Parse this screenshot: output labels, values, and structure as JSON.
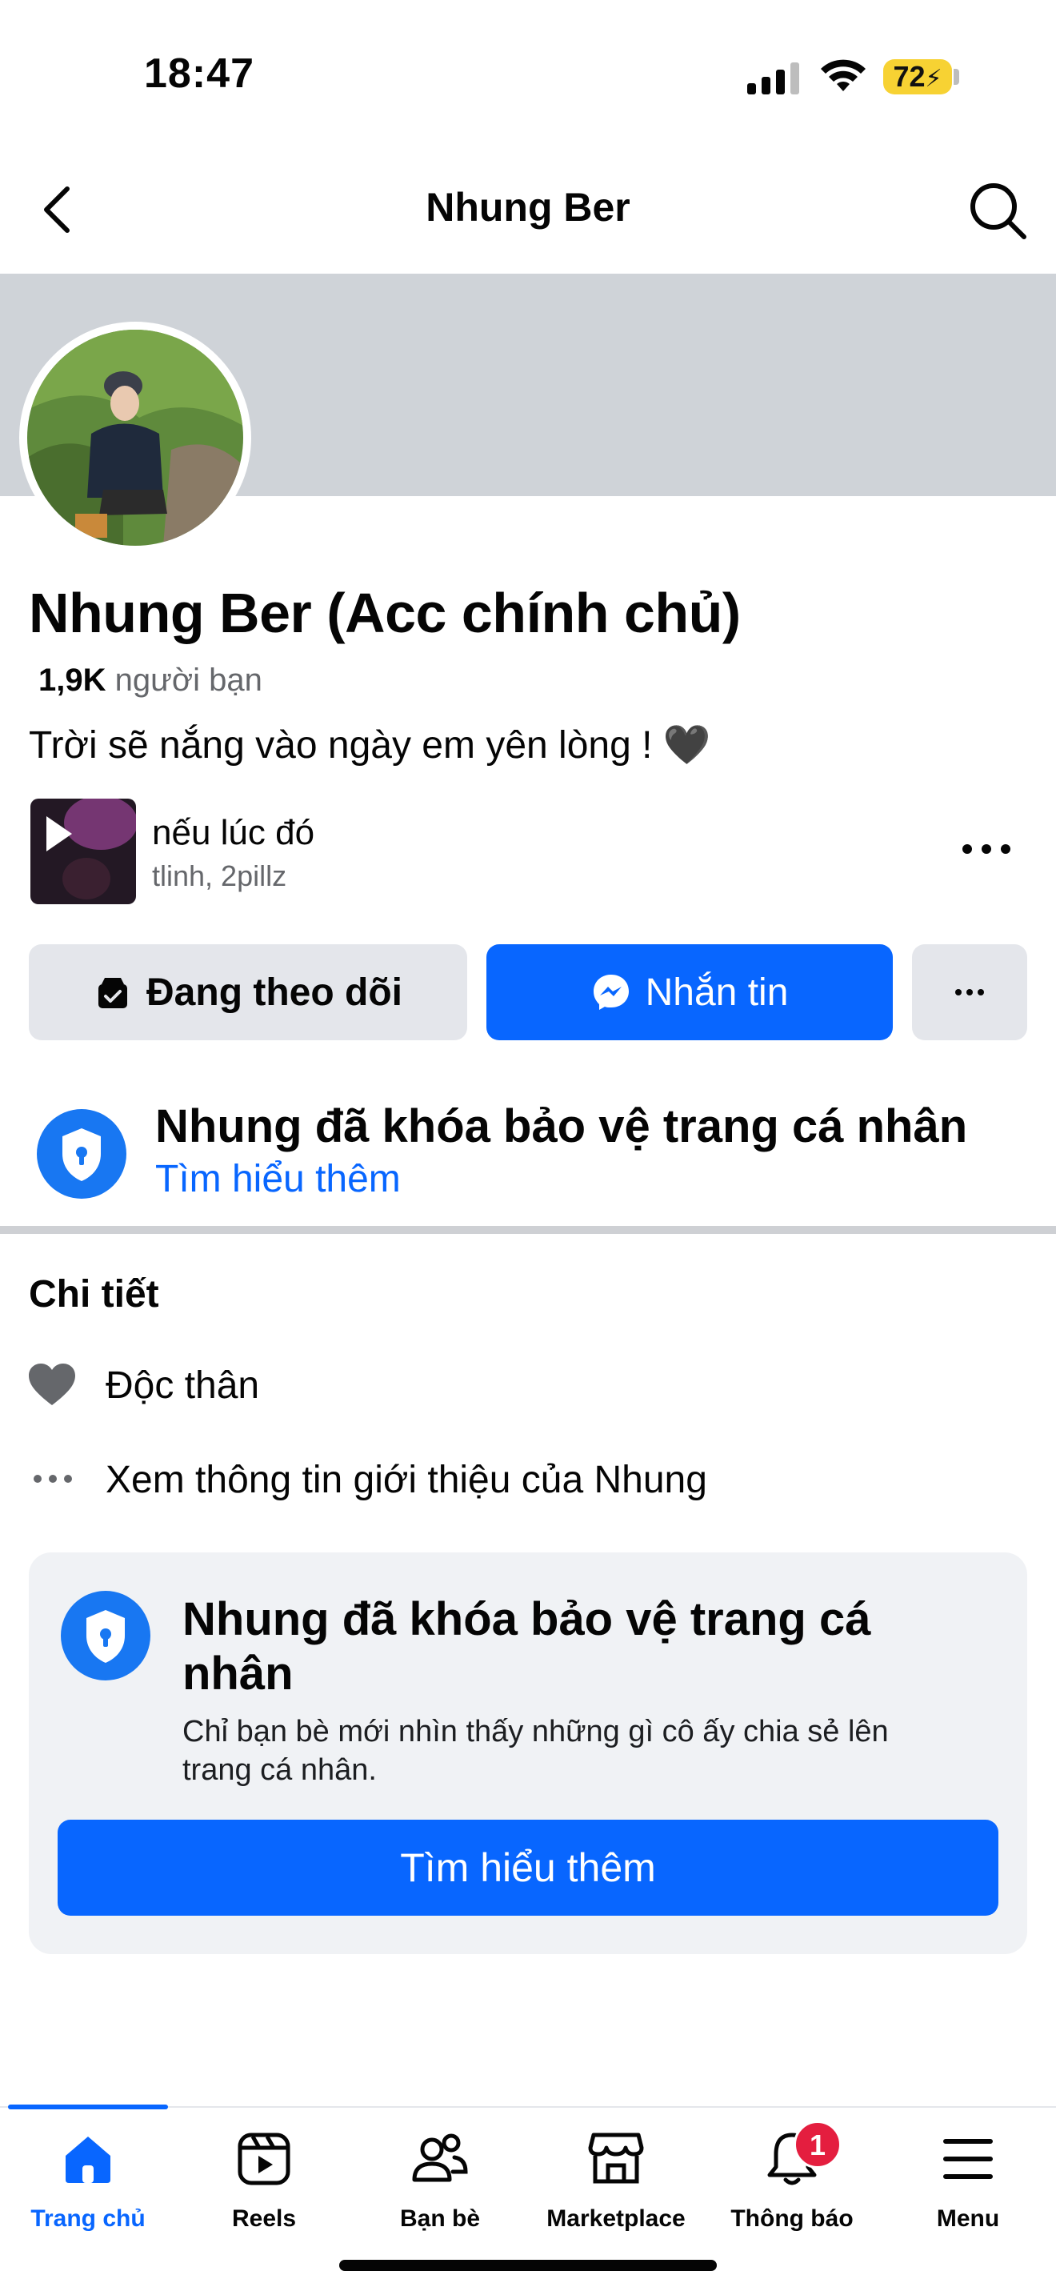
{
  "status_bar": {
    "time": "18:47",
    "battery": "72",
    "icons": [
      "signal-icon",
      "wifi-icon",
      "battery-icon"
    ]
  },
  "header": {
    "title": "Nhung Ber",
    "back_icon": "chevron-left-icon",
    "search_icon": "search-icon"
  },
  "profile": {
    "name": "Nhung Ber (Acc chính chủ)",
    "friends_count": "1,9K",
    "friends_label": "người bạn",
    "bio": "Trời sẽ nắng vào ngày em yên lòng ! 🖤"
  },
  "music": {
    "title": "nếu lúc đó",
    "artist": "tlinh, 2pillz"
  },
  "actions": {
    "follow_label": "Đang theo dõi",
    "message_label": "Nhắn tin",
    "more_label": "···"
  },
  "lock_notice": {
    "title": "Nhung đã khóa bảo vệ trang cá nhân",
    "link": "Tìm hiểu thêm"
  },
  "details": {
    "title": "Chi tiết",
    "relationship": "Độc thân",
    "intro_link": "Xem thông tin giới thiệu của Nhung"
  },
  "lock_card": {
    "title": "Nhung đã khóa bảo vệ trang cá nhân",
    "description": "Chỉ bạn bè mới nhìn thấy những gì cô ấy chia sẻ lên trang cá nhân.",
    "button": "Tìm hiểu thêm"
  },
  "nav": {
    "items": [
      {
        "label": "Trang chủ",
        "icon": "home-icon",
        "active": true
      },
      {
        "label": "Reels",
        "icon": "reels-icon"
      },
      {
        "label": "Bạn bè",
        "icon": "friends-icon"
      },
      {
        "label": "Marketplace",
        "icon": "marketplace-icon"
      },
      {
        "label": "Thông báo",
        "icon": "bell-icon"
      },
      {
        "label": "Menu",
        "icon": "menu-icon"
      }
    ],
    "notification_badge": "1"
  },
  "colors": {
    "accent": "#0866ff",
    "badge": "#e41e3f",
    "cover": "#cfd3d8",
    "button_gray": "#e4e6eb"
  }
}
